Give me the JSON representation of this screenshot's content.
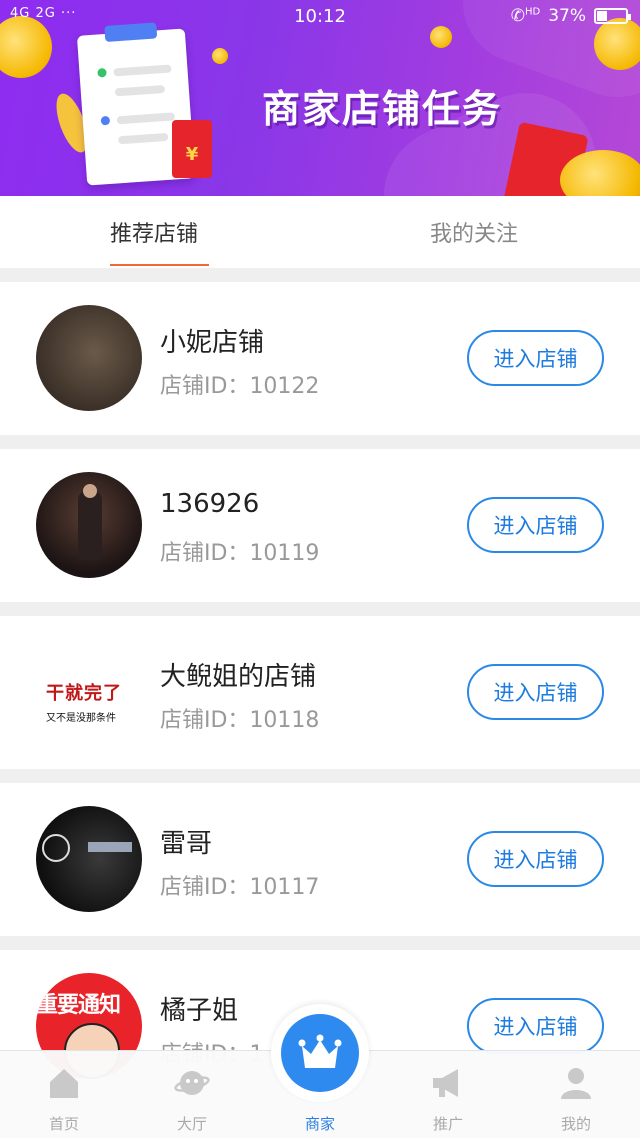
{
  "status_bar": {
    "signal": "4G 2G",
    "more": "···",
    "time": "10:12",
    "hd": "HD",
    "battery": "37%",
    "battery_level": 0.37
  },
  "banner": {
    "title": "商家店铺任务",
    "envelope_symbol": "¥"
  },
  "tabs": [
    {
      "label": "推荐店铺",
      "active": true
    },
    {
      "label": "我的关注",
      "active": false
    }
  ],
  "shops": [
    {
      "name": "小妮店铺",
      "id_label": "店铺ID：",
      "id": "10122",
      "button": "进入店铺"
    },
    {
      "name": "136926",
      "id_label": "店铺ID：",
      "id": "10119",
      "button": "进入店铺"
    },
    {
      "name": "大鲵姐的店铺",
      "id_label": "店铺ID：",
      "id": "10118",
      "button": "进入店铺",
      "avatar_text": "干就完了",
      "avatar_subtext": "又不是没那条件"
    },
    {
      "name": "雷哥",
      "id_label": "店铺ID：",
      "id": "10117",
      "button": "进入店铺"
    },
    {
      "name": "橘子姐",
      "id_label": "店铺ID：",
      "id": "1",
      "button": "进入店铺",
      "avatar_text": "重要通知"
    }
  ],
  "bottom_nav": [
    {
      "label": "首页",
      "icon": "home-icon",
      "active": false
    },
    {
      "label": "大厅",
      "icon": "planet-icon",
      "active": false
    },
    {
      "label": "商家",
      "icon": "crown-icon",
      "active": true
    },
    {
      "label": "推广",
      "icon": "megaphone-icon",
      "active": false
    },
    {
      "label": "我的",
      "icon": "user-icon",
      "active": false
    }
  ],
  "colors": {
    "accent_blue": "#2e7fe5",
    "tab_underline": "#f06a35",
    "banner_purple": "#8e2cf0"
  }
}
